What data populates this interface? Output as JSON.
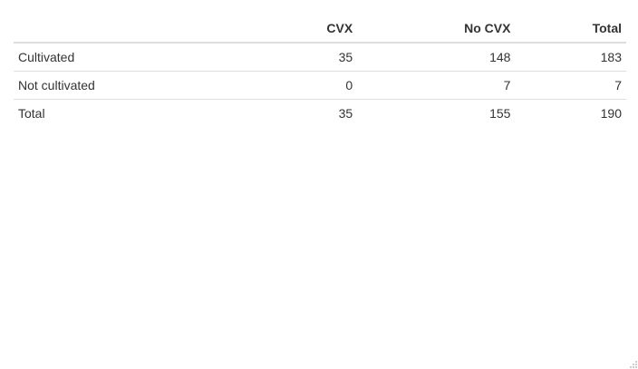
{
  "table": {
    "headers": [
      "",
      "CVX",
      "No CVX",
      "Total"
    ],
    "rows": [
      {
        "label": "Cultivated",
        "cvx": "35",
        "no_cvx": "148",
        "total": "183"
      },
      {
        "label": "Not cultivated",
        "cvx": "0",
        "no_cvx": "7",
        "total": "7"
      },
      {
        "label": "Total",
        "cvx": "35",
        "no_cvx": "155",
        "total": "190"
      }
    ]
  },
  "icons": {
    "resize_grip": "resize-grip-icon"
  },
  "colors": {
    "text": "#333333",
    "rule": "#dddddd",
    "background": "#ffffff"
  }
}
